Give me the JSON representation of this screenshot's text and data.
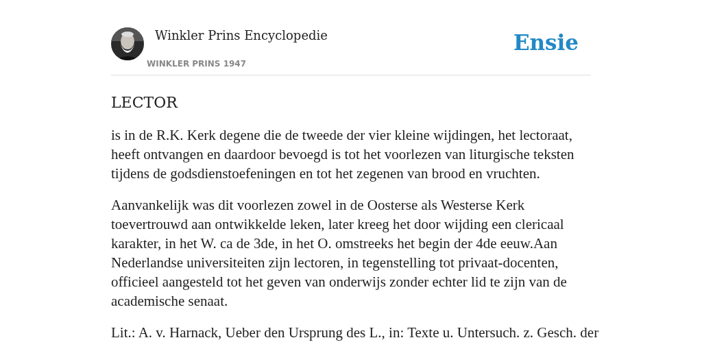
{
  "header": {
    "title": "Winkler Prins Encyclopedie",
    "subtitle": "WINKLER PRINS 1947",
    "logo": "Ensie"
  },
  "article": {
    "heading": "LECTOR",
    "paragraphs": [
      "is in de R.K. Kerk degene die de tweede der vier kleine wijdingen, het lectoraat, heeft ontvangen en daardoor bevoegd is tot het voorlezen van liturgische teksten tijdens de godsdienstoefeningen en tot het zegenen van brood en vruchten.",
      "Aanvankelijk was dit voorlezen zowel in de Oosterse als Westerse Kerk toevertrouwd aan ontwikkelde leken, later kreeg het door wijding een clericaal karakter, in het W. ca de 3de, in het O. omstreeks het begin der 4de eeuw.Aan Nederlandse universiteiten zijn lectoren, in tegenstelling tot privaat-docenten, officieel aangesteld tot het geven van onderwijs zonder echter lid te zijn van de academische senaat.",
      "Lit.: A. v. Harnack, Ueber den Ursprung des L., in: Texte u. Untersuch. z. Gesch. der"
    ]
  }
}
